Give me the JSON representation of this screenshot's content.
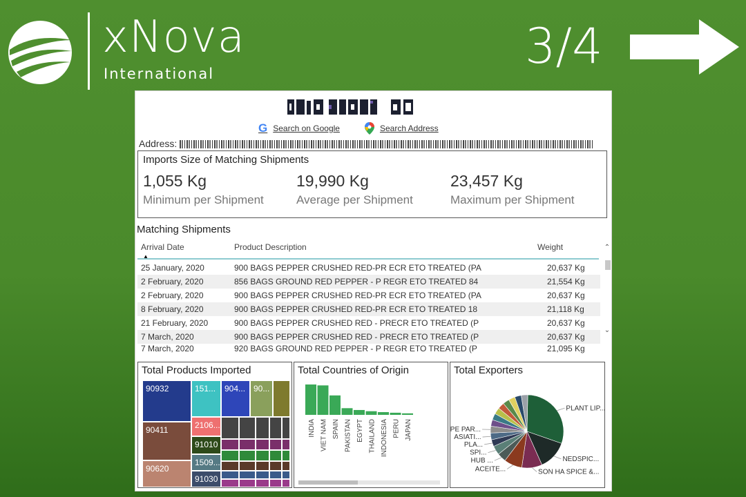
{
  "brand": {
    "name": "xNova",
    "subtitle": "International"
  },
  "page_counter": "3/4",
  "report": {
    "search_google": "Search on Google",
    "search_address": "Search Address",
    "address_label": "Address:",
    "kpi": {
      "title": "Imports Size of Matching Shipments",
      "items": [
        {
          "value": "1,055 Kg",
          "label": "Minimum per Shipment"
        },
        {
          "value": "19,990 Kg",
          "label": "Average per Shipment"
        },
        {
          "value": "23,457 Kg",
          "label": "Maximum per Shipment"
        }
      ]
    },
    "shipments": {
      "title": "Matching Shipments",
      "columns": [
        "Arrival Date",
        "Product Description",
        "Weight"
      ],
      "rows": [
        [
          "25 January, 2020",
          "900 BAGS PEPPER CRUSHED RED-PR ECR ETO TREATED (PA",
          "20,637 Kg"
        ],
        [
          "2 February, 2020",
          "856 BAGS GROUND RED PEPPER - P REGR ETO TREATED 84",
          "21,554 Kg"
        ],
        [
          "2 February, 2020",
          "900 BAGS PEPPER CRUSHED RED-PR ECR ETO TREATED (PA",
          "20,637 Kg"
        ],
        [
          "8 February, 2020",
          "900 BAGS PEPPER CRUSHED RED-PR ECR ETO TREATED 18",
          "21,118 Kg"
        ],
        [
          "21 February, 2020",
          "900 BAGS PEPPER CRUSHED RED - PRECR ETO TREATED (P",
          "20,637 Kg"
        ],
        [
          "7 March, 2020",
          "900 BAGS PEPPER CRUSHED RED - PRECR ETO TREATED (P",
          "20,637 Kg"
        ],
        [
          "7 March, 2020",
          "920 BAGS GROUND RED PEPPER - P REGR ETO TREATED (P",
          "21,095 Kg"
        ]
      ]
    },
    "products": {
      "title": "Total Products Imported",
      "tiles": [
        "90932",
        "151...",
        "904...",
        "90...",
        "90411",
        "2106...",
        "91010",
        "1509...",
        "90620",
        "91030"
      ]
    },
    "countries": {
      "title": "Total Countries of Origin",
      "chart_data": {
        "type": "bar",
        "categories": [
          "INDIA",
          "VIET NAM",
          "SPAIN",
          "PAKISTAN",
          "EGYPT",
          "THAILAND",
          "INDONESIA",
          "PERU",
          "JAPAN"
        ],
        "values": [
          100,
          97,
          64,
          22,
          16,
          12,
          9,
          7,
          5
        ],
        "color": "#3aa957"
      }
    },
    "exporters": {
      "title": "Total Exporters",
      "chart_data": {
        "type": "pie",
        "labels": [
          "PLANT LIP...",
          "NEDSPIC...",
          "SON HA SPICE &...",
          "ACEITE...",
          "HUB ...",
          "SPI...",
          "PLA...",
          "ASIATI...",
          "IRUPE PAR..."
        ],
        "values": [
          30,
          13,
          9,
          8,
          4,
          4,
          3,
          3,
          3
        ],
        "colors": [
          "#1e5f38",
          "#1e2a28",
          "#7a2c52",
          "#8b3a1f",
          "#4c5b58",
          "#5a7f77",
          "#2f3a55",
          "#4d6a86",
          "#8c8c8c"
        ]
      }
    }
  }
}
